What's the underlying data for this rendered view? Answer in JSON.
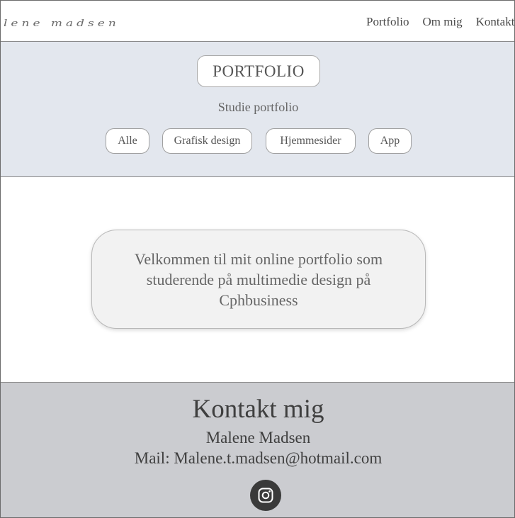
{
  "header": {
    "logo": "lene madsen",
    "nav": [
      "Portfolio",
      "Om mig",
      "Kontakt"
    ]
  },
  "hero": {
    "title": "PORTFOLIO",
    "subtitle": "Studie portfolio",
    "filters": [
      "Alle",
      "Grafisk design",
      "Hjemmesider",
      "App"
    ]
  },
  "main": {
    "welcome_text": "Velkommen til mit online portfolio som studerende på multimedie design på Cphbusiness"
  },
  "footer": {
    "title": "Kontakt mig",
    "name": "Malene Madsen",
    "mail": "Mail: Malene.t.madsen@hotmail.com",
    "social_icon": "instagram-icon"
  },
  "colors": {
    "hero_bg": "#e3e7ee",
    "footer_bg": "#cbccd0",
    "icon_bg": "#3a3a3a"
  }
}
